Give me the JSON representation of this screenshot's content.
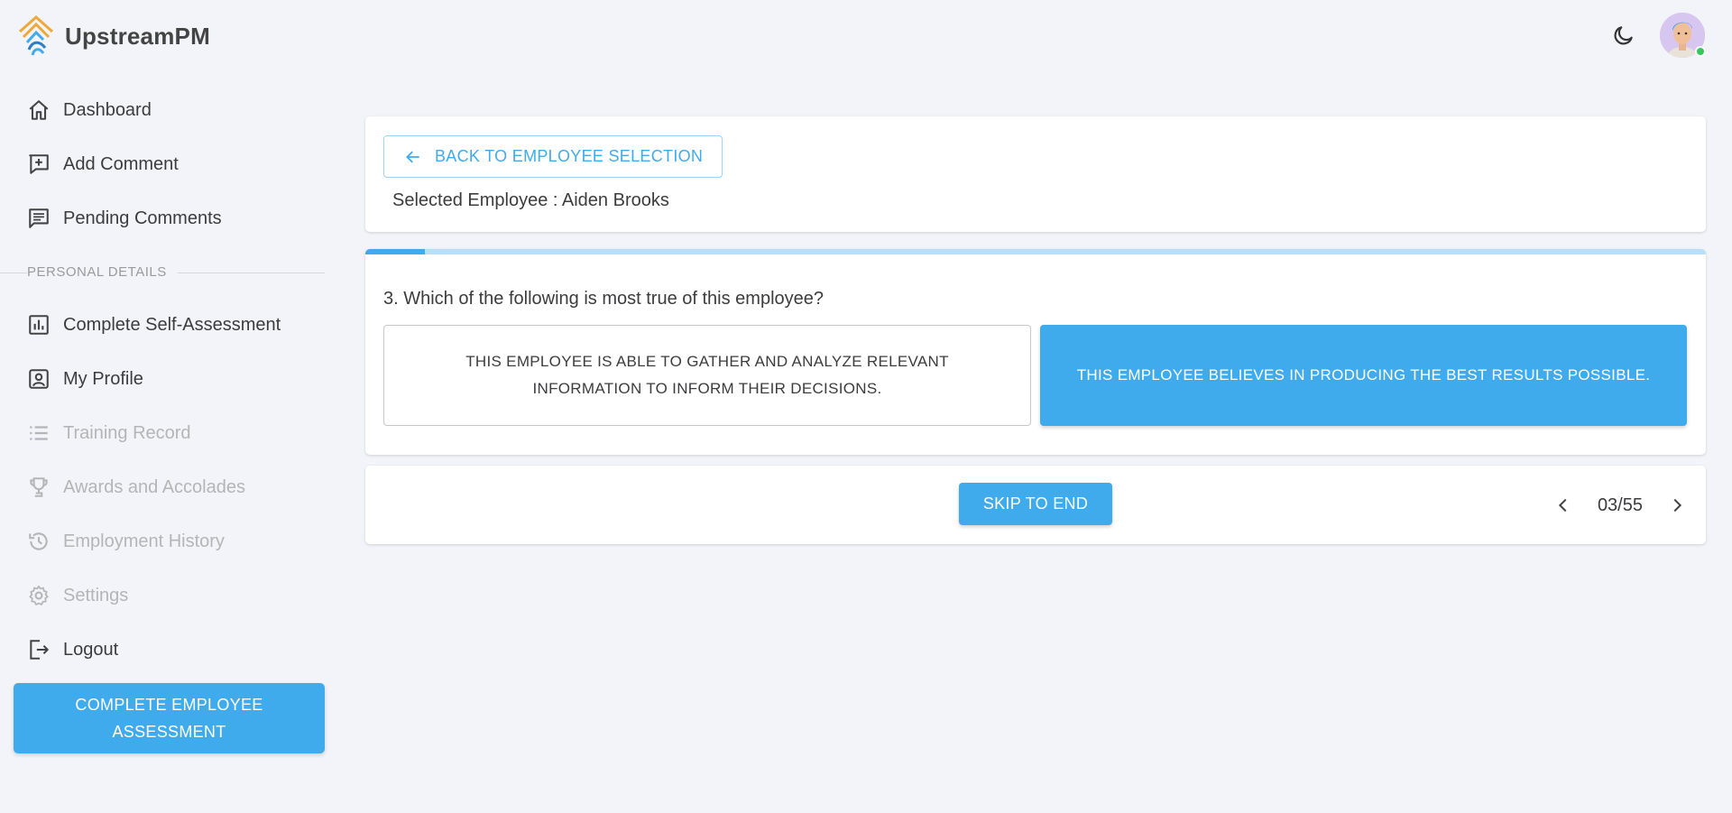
{
  "app": {
    "name": "UpstreamPM"
  },
  "header": {
    "theme_toggle_icon": "moon-icon",
    "avatar_icon": "user-avatar",
    "online_color": "#35c759"
  },
  "sidebar": {
    "items": [
      {
        "label": "Dashboard",
        "icon": "home-icon",
        "disabled": false
      },
      {
        "label": "Add Comment",
        "icon": "add-box-icon",
        "disabled": false
      },
      {
        "label": "Pending Comments",
        "icon": "comment-list-icon",
        "disabled": false
      }
    ],
    "section_label": "PERSONAL DETAILS",
    "personal_items": [
      {
        "label": "Complete Self-Assessment",
        "icon": "bar-chart-icon",
        "disabled": false
      },
      {
        "label": "My Profile",
        "icon": "profile-card-icon",
        "disabled": false
      },
      {
        "label": "Training Record",
        "icon": "list-icon",
        "disabled": true
      },
      {
        "label": "Awards and Accolades",
        "icon": "trophy-icon",
        "disabled": true
      },
      {
        "label": "Employment History",
        "icon": "history-icon",
        "disabled": true
      },
      {
        "label": "Settings",
        "icon": "gear-icon",
        "disabled": true
      },
      {
        "label": "Logout",
        "icon": "logout-icon",
        "disabled": false
      }
    ],
    "cta_line1": "COMPLETE EMPLOYEE",
    "cta_line2": "ASSESSMENT"
  },
  "main": {
    "back_label": "BACK TO EMPLOYEE SELECTION",
    "selected_employee": "Selected Employee : Aiden Brooks",
    "progress_fraction": 0.0447,
    "question": "3. Which of the following is most true of this employee?",
    "answer_a": "THIS EMPLOYEE IS ABLE TO GATHER AND ANALYZE RELEVANT INFORMATION TO INFORM THEIR DECISIONS.",
    "answer_b": "THIS EMPLOYEE BELIEVES IN PRODUCING THE BEST RESULTS POSSIBLE.",
    "skip_label": "SKIP TO END",
    "page_count": "03/55"
  },
  "colors": {
    "accent": "#3fabed",
    "accent_light": "#b7dff8",
    "background": "#f3f4f9"
  }
}
